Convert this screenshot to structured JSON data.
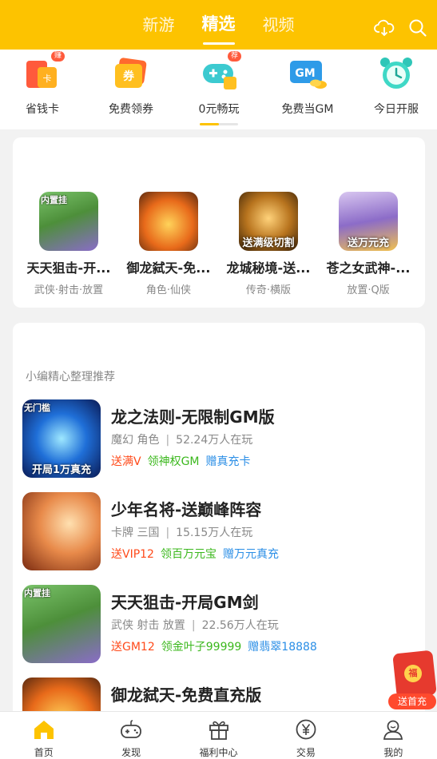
{
  "header": {
    "tabs": [
      "新游",
      "精选",
      "视频"
    ],
    "active_tab": 1,
    "bg_color": "#fdc300",
    "icons": [
      "cloud-download-icon",
      "search-icon"
    ]
  },
  "quick_entries": [
    {
      "label": "省钱卡",
      "badge": "赚",
      "icon": "card-icon"
    },
    {
      "label": "免费领券",
      "badge": "",
      "icon": "coupon-icon"
    },
    {
      "label": "0元畅玩",
      "badge": "荐",
      "icon": "gamepad-icon"
    },
    {
      "label": "免费当GM",
      "badge": "",
      "icon": "gm-icon"
    },
    {
      "label": "今日开服",
      "badge": "",
      "icon": "alarm-clock-icon"
    }
  ],
  "featured": [
    {
      "name": "天天狙击-开...",
      "tags": "武侠·射击·放置",
      "thumb_text": "内置挂"
    },
    {
      "name": "御龙弑天-免...",
      "tags": "角色·仙侠",
      "thumb_text": ""
    },
    {
      "name": "龙城秘境-送...",
      "tags": "传奇·横版",
      "thumb_text": "送满级切割"
    },
    {
      "name": "苍之女武神-...",
      "tags": "放置·Q版",
      "thumb_text": "送万元充"
    }
  ],
  "recommend": {
    "section_title": "小编精心整理推荐",
    "games": [
      {
        "title": "龙之法则-无限制GM版",
        "genre": "魔幻 角色",
        "players": "52.24万人在玩",
        "perks": [
          "送满V",
          "领神权GM",
          "赠真充卡"
        ],
        "thumb_top": "无门槛",
        "thumb_caption": "开局1万真充"
      },
      {
        "title": "少年名将-送巅峰阵容",
        "genre": "卡牌 三国",
        "players": "15.15万人在玩",
        "perks": [
          "送VIP12",
          "领百万元宝",
          "赠万元真充"
        ],
        "thumb_top": "",
        "thumb_caption": ""
      },
      {
        "title": "天天狙击-开局GM剑",
        "genre": "武侠 射击 放置",
        "players": "22.56万人在玩",
        "perks": [
          "送GM12",
          "领金叶子99999",
          "赠翡翠18888"
        ],
        "thumb_top": "内置挂",
        "thumb_caption": ""
      },
      {
        "title": "御龙弑天-免费直充版",
        "genre": "",
        "players": "",
        "perks": [],
        "thumb_top": "",
        "thumb_caption": ""
      }
    ]
  },
  "float_gift": {
    "label": "送首充",
    "coin": "福"
  },
  "bottom_nav": [
    {
      "label": "首页",
      "icon": "home-icon",
      "active": true
    },
    {
      "label": "发现",
      "icon": "gamepad-icon"
    },
    {
      "label": "福利中心",
      "icon": "gift-icon"
    },
    {
      "label": "交易",
      "icon": "yen-icon"
    },
    {
      "label": "我的",
      "icon": "profile-icon"
    }
  ]
}
